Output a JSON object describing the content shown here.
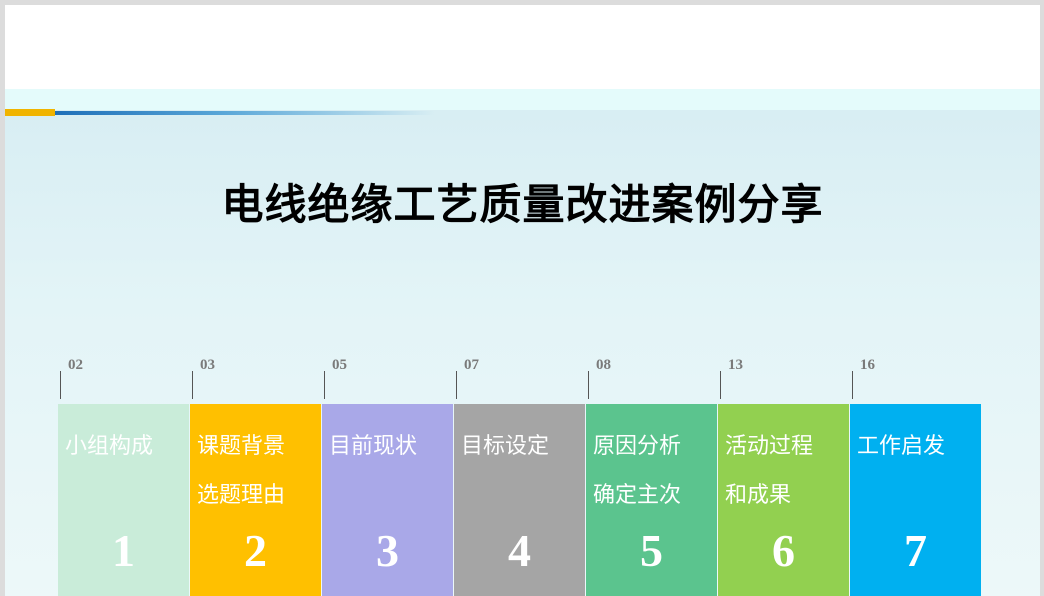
{
  "title": "电线绝缘工艺质量改进案例分享",
  "colors": {
    "accent_yellow": "#f0b400",
    "accent_blue": "#1e6fb8"
  },
  "sections": [
    {
      "page": "02",
      "label": "小组构成",
      "number": "1",
      "color": "#c9ecd9"
    },
    {
      "page": "03",
      "label": "课题背景\n选题理由",
      "number": "2",
      "color": "#ffc000"
    },
    {
      "page": "05",
      "label": "目前现状",
      "number": "3",
      "color": "#a9a8e8"
    },
    {
      "page": "07",
      "label": "目标设定",
      "number": "4",
      "color": "#a5a5a5"
    },
    {
      "page": "08",
      "label": "原因分析\n确定主次",
      "number": "5",
      "color": "#5bc48e"
    },
    {
      "page": "13",
      "label": "活动过程\n和成果",
      "number": "6",
      "color": "#92d050"
    },
    {
      "page": "16",
      "label": "工作启发",
      "number": "7",
      "color": "#00b0f0"
    }
  ]
}
